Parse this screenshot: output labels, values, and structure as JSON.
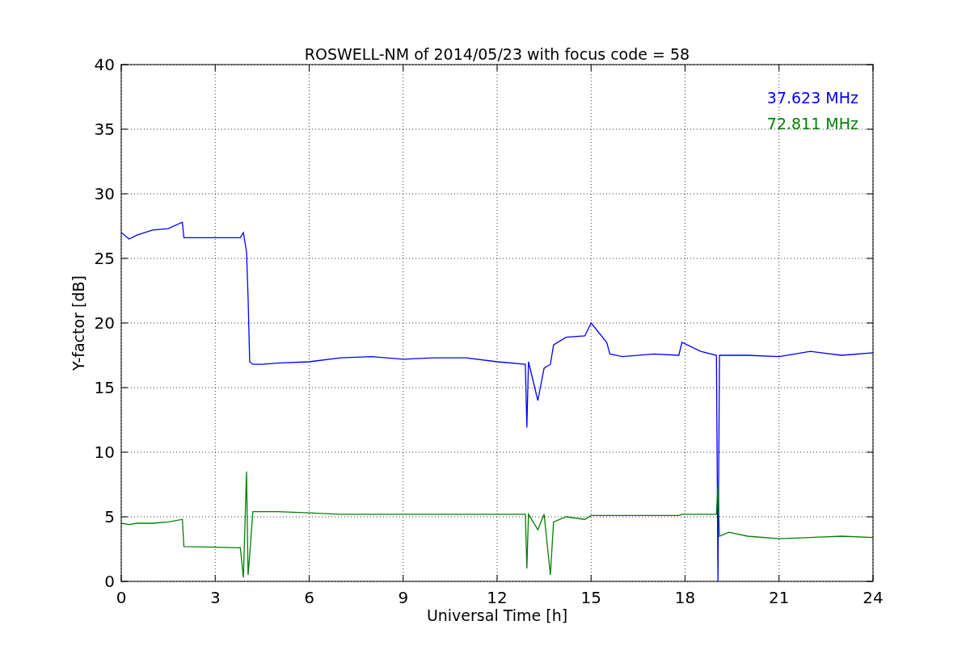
{
  "chart_data": {
    "type": "line",
    "title": "ROSWELL-NM of 2014/05/23 with focus code = 58",
    "xlabel": "Universal Time [h]",
    "ylabel": "Y-factor [dB]",
    "x": [
      0,
      0.25,
      0.5,
      1,
      1.5,
      1.95,
      2,
      3.8,
      3.9,
      4,
      4.05,
      4.1,
      4.2,
      4.5,
      5,
      6,
      7,
      8,
      9,
      10,
      11,
      12,
      12.9,
      12.95,
      13,
      13.3,
      13.5,
      13.7,
      13.8,
      14.2,
      14.8,
      15,
      15.5,
      15.6,
      16,
      17,
      17.8,
      17.9,
      18.5,
      19,
      19.05,
      19.1,
      19.4,
      20,
      21,
      22,
      23,
      24
    ],
    "series": [
      {
        "name": "37.623 MHz",
        "color": "#0000ff",
        "values": [
          27,
          26.5,
          26.8,
          27.2,
          27.3,
          27.8,
          26.6,
          26.6,
          27,
          25.5,
          22,
          17,
          16.8,
          16.8,
          16.9,
          17,
          17.3,
          17.4,
          17.2,
          17.3,
          17.3,
          17,
          16.8,
          11.9,
          17,
          14,
          16.5,
          16.8,
          18.3,
          18.9,
          19,
          20,
          18.5,
          17.6,
          17.4,
          17.6,
          17.5,
          18.5,
          17.8,
          17.5,
          0,
          17.5,
          17.5,
          17.5,
          17.4,
          17.8,
          17.5,
          17.7
        ]
      },
      {
        "name": "72.811 MHz",
        "color": "#008000",
        "values": [
          4.5,
          4.4,
          4.5,
          4.5,
          4.6,
          4.8,
          2.7,
          2.6,
          0.3,
          8.5,
          0.5,
          2,
          5.4,
          5.4,
          5.4,
          5.3,
          5.2,
          5.2,
          5.2,
          5.2,
          5.2,
          5.2,
          5.2,
          1,
          5.2,
          4,
          5.2,
          0.5,
          4.6,
          5,
          4.8,
          5.1,
          5.1,
          5.1,
          5.1,
          5.1,
          5.1,
          5.2,
          5.2,
          5.2,
          7.5,
          3.5,
          3.8,
          3.5,
          3.3,
          3.4,
          3.5,
          3.4
        ]
      }
    ],
    "xlim": [
      0,
      24
    ],
    "ylim": [
      0,
      40
    ],
    "xticks": [
      0,
      3,
      6,
      9,
      12,
      15,
      18,
      21,
      24
    ],
    "yticks": [
      0,
      5,
      10,
      15,
      20,
      25,
      30,
      35,
      40
    ],
    "grid": true
  }
}
